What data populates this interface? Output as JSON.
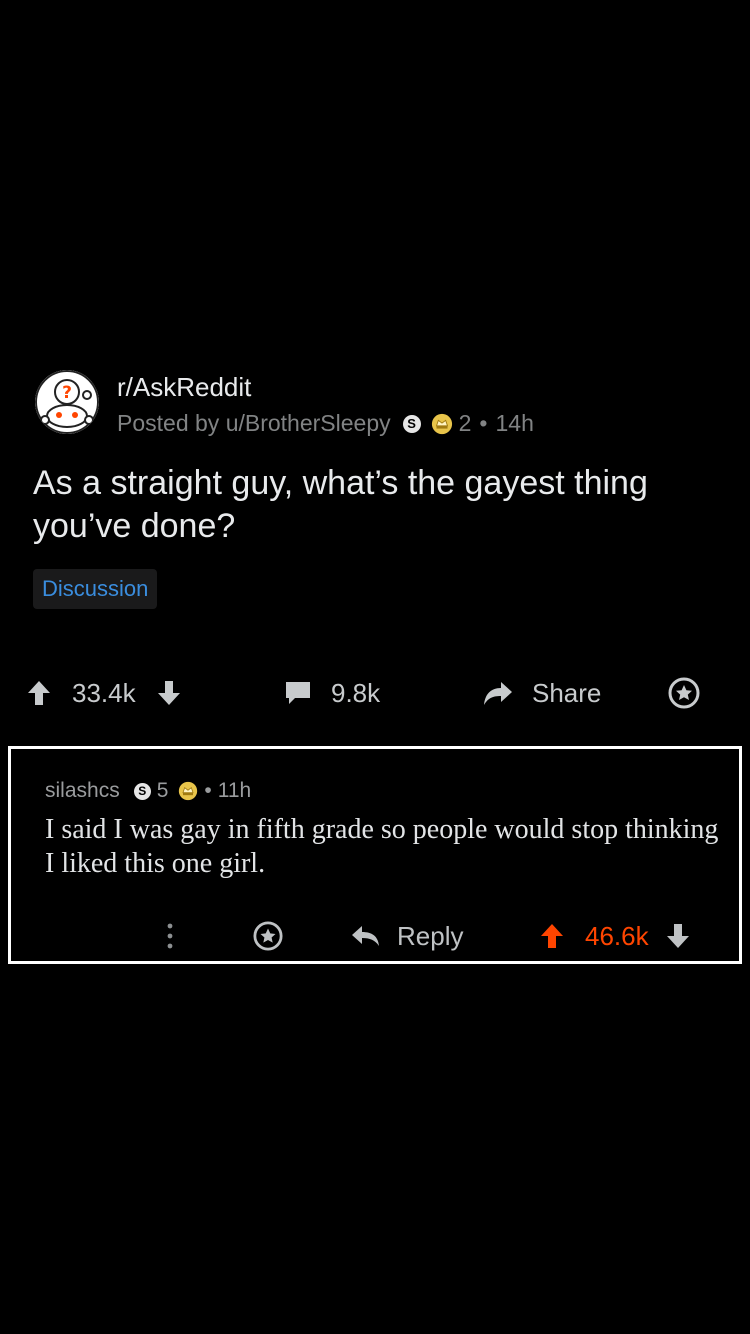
{
  "post": {
    "subreddit": "r/AskReddit",
    "posted_by_prefix": "Posted by",
    "author": "u/BrotherSleepy",
    "award_count": "2",
    "dot": "•",
    "age": "14h",
    "title": "As a straight guy, what’s the gayest thing you’ve done?",
    "flair": "Discussion",
    "score": "33.4k",
    "comments": "9.8k",
    "share_label": "Share",
    "coin_s_letter": "S"
  },
  "comment": {
    "author": "silashcs",
    "award_count": "5",
    "dot": "•",
    "age": "11h",
    "coin_s_letter": "S",
    "body": "I said I was gay in fifth grade so people would stop thinking I liked this one girl.",
    "reply_label": "Reply",
    "score": "46.6k",
    "score_color": "#ff4500"
  }
}
